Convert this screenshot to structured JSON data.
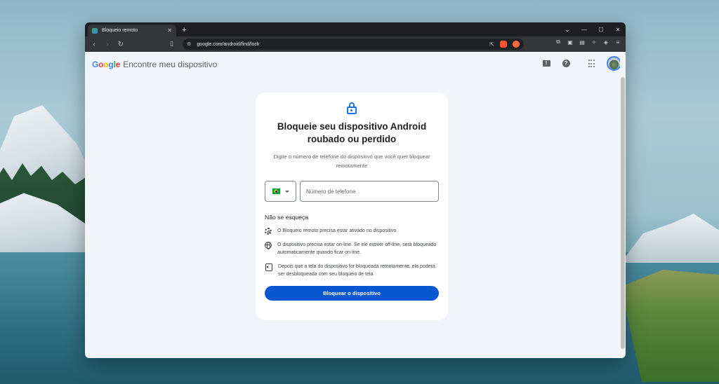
{
  "browser": {
    "tab_title": "Bloqueio remoto",
    "new_tab": "+",
    "url": "google.com/android/find/lock",
    "window_controls": [
      "chevron-down-icon",
      "minimize-icon",
      "maximize-icon",
      "close-icon"
    ]
  },
  "app": {
    "logo": {
      "G": "G",
      "o1": "o",
      "o2": "o",
      "g": "g",
      "l": "l",
      "e": "e"
    },
    "title": "Encontre meu dispositivo",
    "actions": [
      "feedback-icon",
      "help-icon",
      "apps-icon",
      "avatar"
    ]
  },
  "card": {
    "title": "Bloqueie seu dispositivo Android roubado ou perdido",
    "subtitle": "Digite o número de telefone do dispositivo que você quer bloquear remotamente",
    "phone": {
      "country_flag": "brazil-flag-icon",
      "placeholder": "Número de telefone",
      "value": ""
    },
    "reminder_title": "Não se esqueça",
    "tips": [
      {
        "icon": "settings-icon",
        "text": "O Bloqueio remoto precisa estar ativado no dispositivo"
      },
      {
        "icon": "globe-icon",
        "text": "O dispositivo precisa estar on-line. Se ele estiver off-line, será bloqueado automaticamente quando ficar on-line."
      },
      {
        "icon": "phone-icon",
        "text": "Depois que a tela do dispositivo for bloqueada remotamente, ela poderá ser desbloqueada com seu bloqueio de tela"
      }
    ],
    "button_label": "Bloquear o dispositivo"
  },
  "colors": {
    "accent": "#0b57d0",
    "lock_icon": "#1a73e8",
    "page_bg": "#f1f4f8"
  }
}
